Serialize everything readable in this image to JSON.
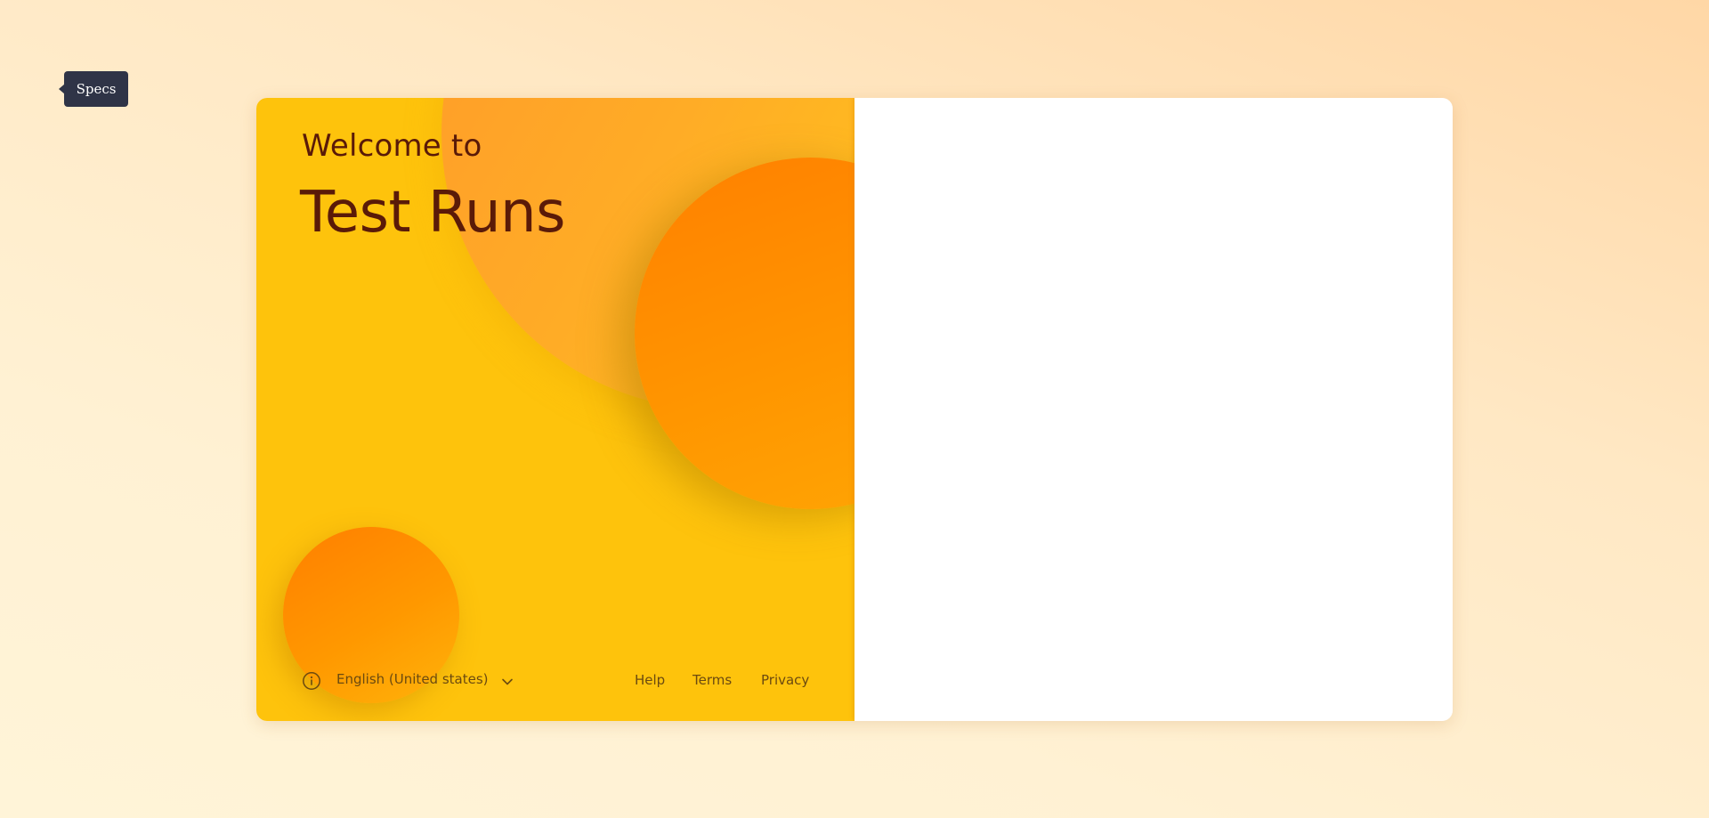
{
  "tooltip": {
    "label": "Specs"
  },
  "welcome": {
    "greeting": "Welcome to",
    "app_name": "Test Runs"
  },
  "footer": {
    "language": "English (United states)",
    "links": {
      "help": "Help",
      "terms": "Terms",
      "privacy": "Privacy"
    }
  },
  "icons": {
    "info": "info-icon",
    "chevron": "chevron-down-icon"
  },
  "colors": {
    "panel_yellow": "#fec30c",
    "accent_orange": "#ff8a00",
    "title_brown": "#5a1a08",
    "tooltip_bg": "#2f3447"
  }
}
